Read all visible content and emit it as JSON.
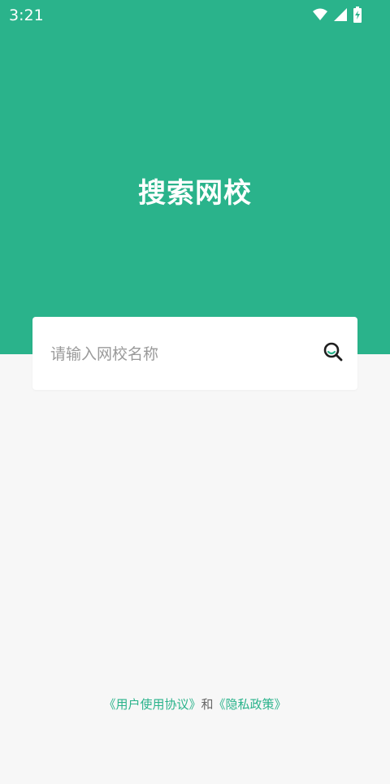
{
  "status_bar": {
    "time": "3:21",
    "icons": [
      "wifi-icon",
      "signal-icon",
      "battery-charging-icon"
    ]
  },
  "header": {
    "title": "搜索网校",
    "background_color": "#2ab38b"
  },
  "search": {
    "placeholder": "请输入网校名称",
    "value": "",
    "icon": "search-icon"
  },
  "footer": {
    "user_agreement": "《用户使用协议》",
    "conjunction": "和",
    "privacy_policy": "《隐私政策》",
    "link_color": "#2ab38b"
  }
}
